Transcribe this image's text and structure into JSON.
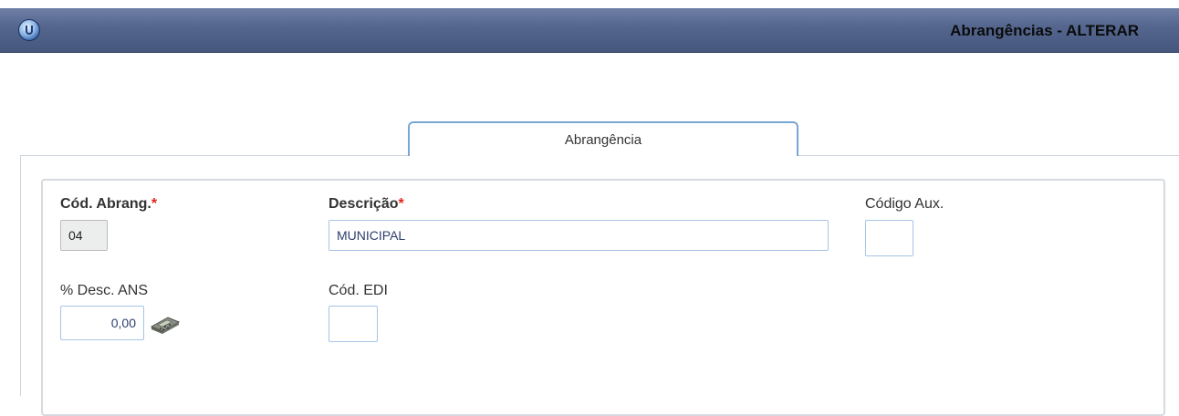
{
  "window": {
    "title": "Abrangências - ALTERAR"
  },
  "tabs": [
    {
      "label": "Abrangência"
    }
  ],
  "form": {
    "cod_abrang": {
      "label": "Cód. Abrang.",
      "required_mark": "*",
      "value": "04"
    },
    "descricao": {
      "label": "Descrição",
      "required_mark": "*",
      "value": "MUNICIPAL"
    },
    "codigo_aux": {
      "label": "Código Aux.",
      "value": ""
    },
    "desc_ans": {
      "label": "% Desc. ANS",
      "value": "0,00"
    },
    "cod_edi": {
      "label": "Cód. EDI",
      "value": ""
    }
  },
  "icons": {
    "app": "app-globe-icon",
    "calculator": "calculator-icon"
  }
}
